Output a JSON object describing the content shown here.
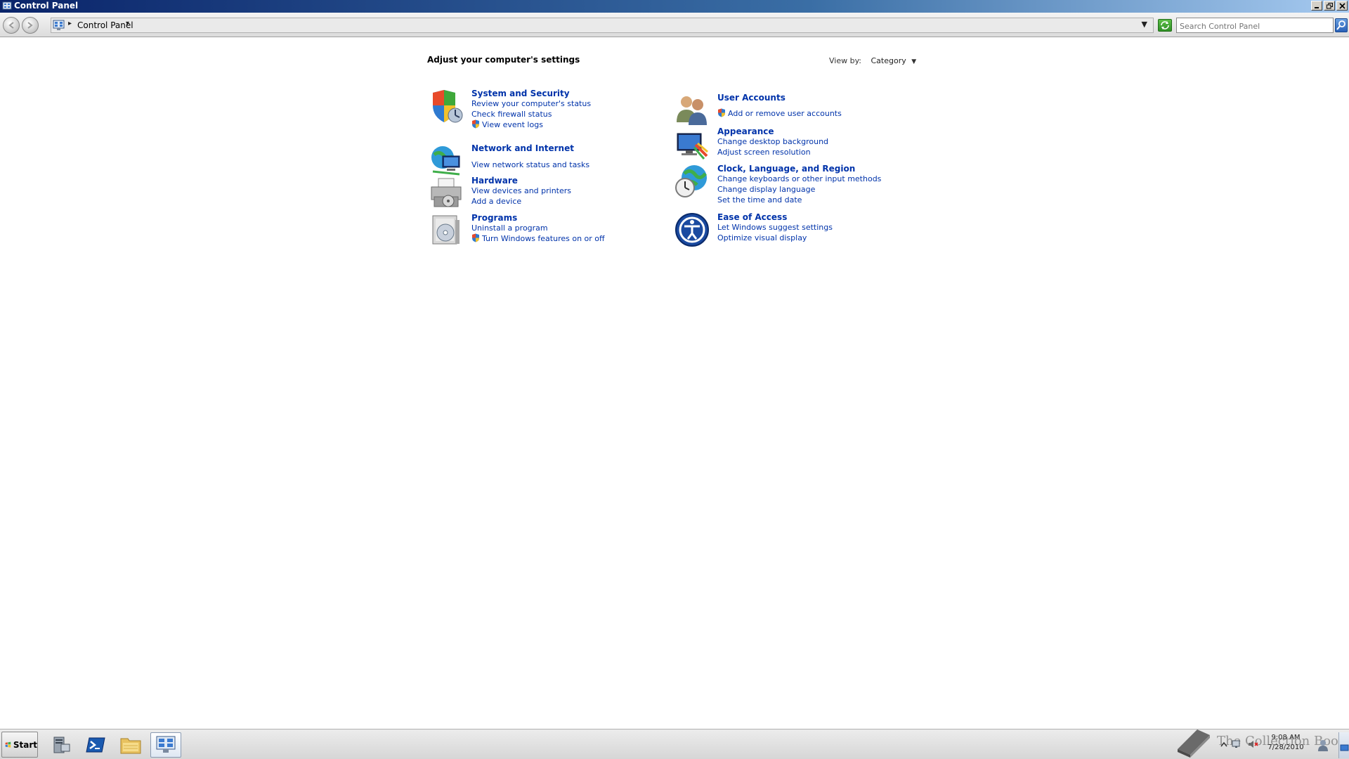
{
  "window": {
    "title": "Control Panel"
  },
  "address_bar": {
    "breadcrumb": "Control Panel",
    "search_placeholder": "Search Control Panel"
  },
  "main": {
    "heading": "Adjust your computer's settings",
    "view_by_label": "View by:",
    "view_by_value": "Category",
    "categories_left": [
      {
        "title": "System and Security",
        "links": [
          "Review your computer's status",
          "Check firewall status",
          "View event logs"
        ],
        "shield_links": [
          false,
          false,
          true
        ],
        "icon": "shield-icon"
      },
      {
        "title": "Network and Internet",
        "links": [
          "View network status and tasks"
        ],
        "shield_links": [
          false
        ],
        "icon": "network-globe-icon"
      },
      {
        "title": "Hardware",
        "links": [
          "View devices and printers",
          "Add a device"
        ],
        "shield_links": [
          false,
          false
        ],
        "icon": "printer-icon"
      },
      {
        "title": "Programs",
        "links": [
          "Uninstall a program",
          "Turn Windows features on or off"
        ],
        "shield_links": [
          false,
          true
        ],
        "icon": "programs-disc-icon"
      }
    ],
    "categories_right": [
      {
        "title": "User Accounts",
        "links": [
          "Add or remove user accounts"
        ],
        "shield_links": [
          true
        ],
        "icon": "users-icon"
      },
      {
        "title": "Appearance",
        "links": [
          "Change desktop background",
          "Adjust screen resolution"
        ],
        "shield_links": [
          false,
          false
        ],
        "icon": "monitor-color-icon"
      },
      {
        "title": "Clock, Language, and Region",
        "links": [
          "Change keyboards or other input methods",
          "Change display language",
          "Set the time and date"
        ],
        "shield_links": [
          false,
          false,
          false
        ],
        "icon": "globe-clock-icon"
      },
      {
        "title": "Ease of Access",
        "links": [
          "Let Windows suggest settings",
          "Optimize visual display"
        ],
        "shield_links": [
          false,
          false
        ],
        "icon": "ease-of-access-icon"
      }
    ]
  },
  "taskbar": {
    "start_label": "Start",
    "apps": [
      "server-manager-icon",
      "powershell-icon",
      "explorer-folder-icon",
      "control-panel-icon"
    ],
    "active_app": "control-panel-icon",
    "clock_time": "9:08 AM",
    "clock_date": "7/28/2010",
    "watermark": "The Collection Book"
  },
  "colors": {
    "link": "#0033aa",
    "title_bar_start": "#0a246a",
    "title_bar_end": "#a6caf0"
  }
}
